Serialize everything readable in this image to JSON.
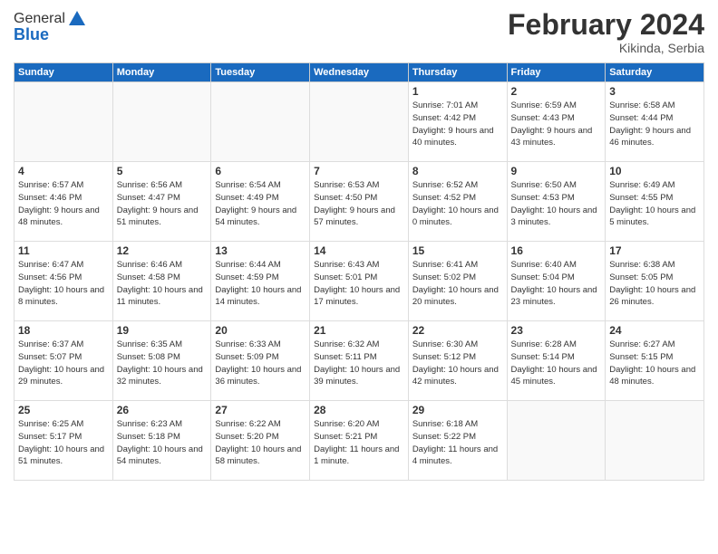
{
  "logo": {
    "general": "General",
    "blue": "Blue"
  },
  "title": {
    "month_year": "February 2024",
    "location": "Kikinda, Serbia"
  },
  "headers": [
    "Sunday",
    "Monday",
    "Tuesday",
    "Wednesday",
    "Thursday",
    "Friday",
    "Saturday"
  ],
  "weeks": [
    [
      {
        "day": "",
        "sunrise": "",
        "sunset": "",
        "daylight": ""
      },
      {
        "day": "",
        "sunrise": "",
        "sunset": "",
        "daylight": ""
      },
      {
        "day": "",
        "sunrise": "",
        "sunset": "",
        "daylight": ""
      },
      {
        "day": "",
        "sunrise": "",
        "sunset": "",
        "daylight": ""
      },
      {
        "day": "1",
        "sunrise": "Sunrise: 7:01 AM",
        "sunset": "Sunset: 4:42 PM",
        "daylight": "Daylight: 9 hours and 40 minutes."
      },
      {
        "day": "2",
        "sunrise": "Sunrise: 6:59 AM",
        "sunset": "Sunset: 4:43 PM",
        "daylight": "Daylight: 9 hours and 43 minutes."
      },
      {
        "day": "3",
        "sunrise": "Sunrise: 6:58 AM",
        "sunset": "Sunset: 4:44 PM",
        "daylight": "Daylight: 9 hours and 46 minutes."
      }
    ],
    [
      {
        "day": "4",
        "sunrise": "Sunrise: 6:57 AM",
        "sunset": "Sunset: 4:46 PM",
        "daylight": "Daylight: 9 hours and 48 minutes."
      },
      {
        "day": "5",
        "sunrise": "Sunrise: 6:56 AM",
        "sunset": "Sunset: 4:47 PM",
        "daylight": "Daylight: 9 hours and 51 minutes."
      },
      {
        "day": "6",
        "sunrise": "Sunrise: 6:54 AM",
        "sunset": "Sunset: 4:49 PM",
        "daylight": "Daylight: 9 hours and 54 minutes."
      },
      {
        "day": "7",
        "sunrise": "Sunrise: 6:53 AM",
        "sunset": "Sunset: 4:50 PM",
        "daylight": "Daylight: 9 hours and 57 minutes."
      },
      {
        "day": "8",
        "sunrise": "Sunrise: 6:52 AM",
        "sunset": "Sunset: 4:52 PM",
        "daylight": "Daylight: 10 hours and 0 minutes."
      },
      {
        "day": "9",
        "sunrise": "Sunrise: 6:50 AM",
        "sunset": "Sunset: 4:53 PM",
        "daylight": "Daylight: 10 hours and 3 minutes."
      },
      {
        "day": "10",
        "sunrise": "Sunrise: 6:49 AM",
        "sunset": "Sunset: 4:55 PM",
        "daylight": "Daylight: 10 hours and 5 minutes."
      }
    ],
    [
      {
        "day": "11",
        "sunrise": "Sunrise: 6:47 AM",
        "sunset": "Sunset: 4:56 PM",
        "daylight": "Daylight: 10 hours and 8 minutes."
      },
      {
        "day": "12",
        "sunrise": "Sunrise: 6:46 AM",
        "sunset": "Sunset: 4:58 PM",
        "daylight": "Daylight: 10 hours and 11 minutes."
      },
      {
        "day": "13",
        "sunrise": "Sunrise: 6:44 AM",
        "sunset": "Sunset: 4:59 PM",
        "daylight": "Daylight: 10 hours and 14 minutes."
      },
      {
        "day": "14",
        "sunrise": "Sunrise: 6:43 AM",
        "sunset": "Sunset: 5:01 PM",
        "daylight": "Daylight: 10 hours and 17 minutes."
      },
      {
        "day": "15",
        "sunrise": "Sunrise: 6:41 AM",
        "sunset": "Sunset: 5:02 PM",
        "daylight": "Daylight: 10 hours and 20 minutes."
      },
      {
        "day": "16",
        "sunrise": "Sunrise: 6:40 AM",
        "sunset": "Sunset: 5:04 PM",
        "daylight": "Daylight: 10 hours and 23 minutes."
      },
      {
        "day": "17",
        "sunrise": "Sunrise: 6:38 AM",
        "sunset": "Sunset: 5:05 PM",
        "daylight": "Daylight: 10 hours and 26 minutes."
      }
    ],
    [
      {
        "day": "18",
        "sunrise": "Sunrise: 6:37 AM",
        "sunset": "Sunset: 5:07 PM",
        "daylight": "Daylight: 10 hours and 29 minutes."
      },
      {
        "day": "19",
        "sunrise": "Sunrise: 6:35 AM",
        "sunset": "Sunset: 5:08 PM",
        "daylight": "Daylight: 10 hours and 32 minutes."
      },
      {
        "day": "20",
        "sunrise": "Sunrise: 6:33 AM",
        "sunset": "Sunset: 5:09 PM",
        "daylight": "Daylight: 10 hours and 36 minutes."
      },
      {
        "day": "21",
        "sunrise": "Sunrise: 6:32 AM",
        "sunset": "Sunset: 5:11 PM",
        "daylight": "Daylight: 10 hours and 39 minutes."
      },
      {
        "day": "22",
        "sunrise": "Sunrise: 6:30 AM",
        "sunset": "Sunset: 5:12 PM",
        "daylight": "Daylight: 10 hours and 42 minutes."
      },
      {
        "day": "23",
        "sunrise": "Sunrise: 6:28 AM",
        "sunset": "Sunset: 5:14 PM",
        "daylight": "Daylight: 10 hours and 45 minutes."
      },
      {
        "day": "24",
        "sunrise": "Sunrise: 6:27 AM",
        "sunset": "Sunset: 5:15 PM",
        "daylight": "Daylight: 10 hours and 48 minutes."
      }
    ],
    [
      {
        "day": "25",
        "sunrise": "Sunrise: 6:25 AM",
        "sunset": "Sunset: 5:17 PM",
        "daylight": "Daylight: 10 hours and 51 minutes."
      },
      {
        "day": "26",
        "sunrise": "Sunrise: 6:23 AM",
        "sunset": "Sunset: 5:18 PM",
        "daylight": "Daylight: 10 hours and 54 minutes."
      },
      {
        "day": "27",
        "sunrise": "Sunrise: 6:22 AM",
        "sunset": "Sunset: 5:20 PM",
        "daylight": "Daylight: 10 hours and 58 minutes."
      },
      {
        "day": "28",
        "sunrise": "Sunrise: 6:20 AM",
        "sunset": "Sunset: 5:21 PM",
        "daylight": "Daylight: 11 hours and 1 minute."
      },
      {
        "day": "29",
        "sunrise": "Sunrise: 6:18 AM",
        "sunset": "Sunset: 5:22 PM",
        "daylight": "Daylight: 11 hours and 4 minutes."
      },
      {
        "day": "",
        "sunrise": "",
        "sunset": "",
        "daylight": ""
      },
      {
        "day": "",
        "sunrise": "",
        "sunset": "",
        "daylight": ""
      }
    ]
  ]
}
